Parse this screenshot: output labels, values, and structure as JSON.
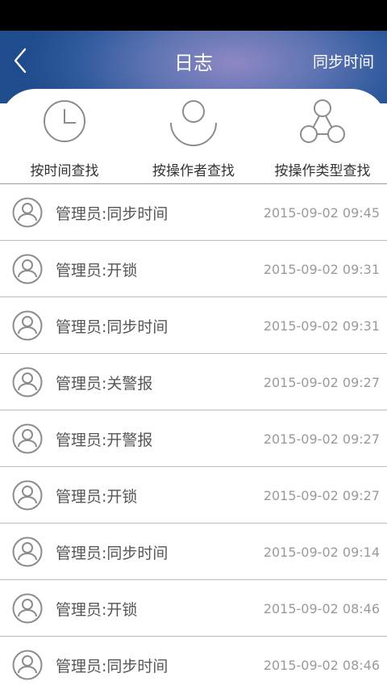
{
  "header": {
    "back_icon": "chevron-left-icon",
    "title": "日志",
    "sync_label": "同步时间"
  },
  "filters": [
    {
      "icon": "clock-icon",
      "label": "按时间查找"
    },
    {
      "icon": "person-icon",
      "label": "按操作者查找"
    },
    {
      "icon": "share-nodes-icon",
      "label": "按操作类型查找"
    }
  ],
  "log": {
    "avatar_icon": "user-circle-icon",
    "rows": [
      {
        "text": "管理员:同步时间",
        "time": "2015-09-02 09:45"
      },
      {
        "text": "管理员:开锁",
        "time": "2015-09-02 09:31"
      },
      {
        "text": "管理员:同步时间",
        "time": "2015-09-02 09:31"
      },
      {
        "text": "管理员:关警报",
        "time": "2015-09-02 09:27"
      },
      {
        "text": "管理员:开警报",
        "time": "2015-09-02 09:27"
      },
      {
        "text": "管理员:开锁",
        "time": "2015-09-02 09:27"
      },
      {
        "text": "管理员:同步时间",
        "time": "2015-09-02 09:14"
      },
      {
        "text": "管理员:开锁",
        "time": "2015-09-02 08:46"
      },
      {
        "text": "管理员:同步时间",
        "time": "2015-09-02 08:46"
      }
    ]
  },
  "colors": {
    "header_blue": "#2f5a9c",
    "status_bar": "#000000",
    "text_dark": "#555555",
    "text_time": "#9a9a9a",
    "icon_gray": "#8c8c8c"
  }
}
